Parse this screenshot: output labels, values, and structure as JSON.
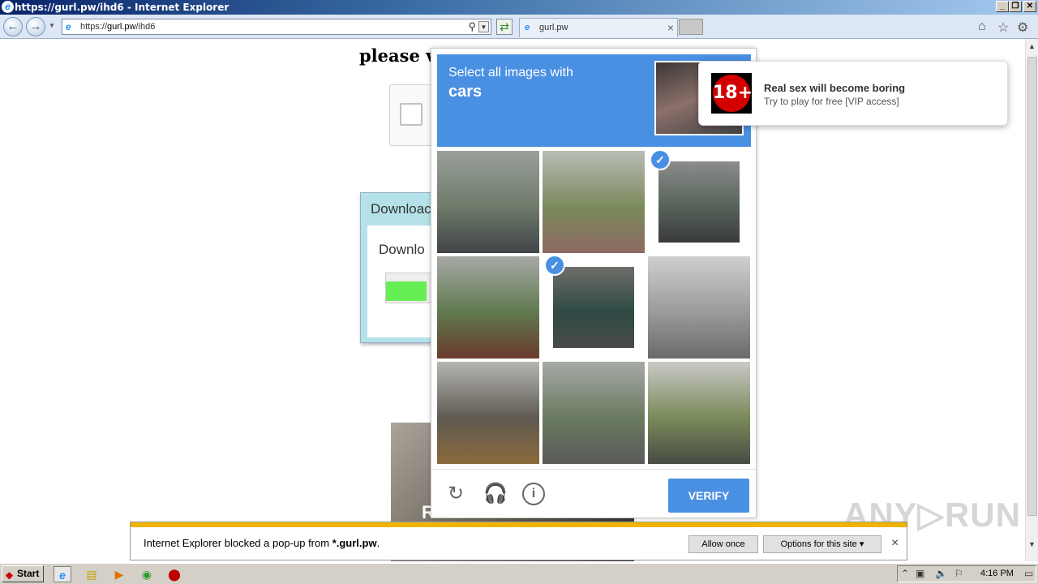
{
  "window": {
    "title": "https://gurl.pw/ihd6 - Internet Explorer",
    "minimize": "_",
    "restore": "❐",
    "close": "✕"
  },
  "toolbar": {
    "url_prefix": "https://",
    "url_host": "gurl.pw",
    "url_path": "/ihd6",
    "tab_label": "gurl.pw",
    "tab_close": "×"
  },
  "page": {
    "heading": "please ve",
    "download_title": "Downloac",
    "download_label": "Downlo",
    "download_progress": 0.75,
    "image_caption": "R"
  },
  "captcha": {
    "prompt": "Select all images with",
    "target": "cars",
    "verify_label": "VERIFY",
    "tiles": [
      {
        "name": "street-car-tile",
        "selected": false,
        "colors": [
          "#9aa09a",
          "#6e7a6a",
          "#404448"
        ]
      },
      {
        "name": "overpass-tile",
        "selected": false,
        "colors": [
          "#b9bcb5",
          "#7b8a5c",
          "#8d6a63"
        ]
      },
      {
        "name": "parked-car-tile",
        "selected": true,
        "colors": [
          "#8c8c8c",
          "#56635a",
          "#3a3a3c"
        ]
      },
      {
        "name": "chase-sign-tile",
        "selected": false,
        "colors": [
          "#a7a9a6",
          "#5f7a4e",
          "#6a3a2e"
        ]
      },
      {
        "name": "green-car-tile",
        "selected": true,
        "colors": [
          "#6f6e6a",
          "#2e4a44",
          "#4a4a48"
        ]
      },
      {
        "name": "empty-road-tile",
        "selected": false,
        "colors": [
          "#cfcfcf",
          "#9a9a9a",
          "#6a6a6a"
        ]
      },
      {
        "name": "traffic-light-tile",
        "selected": false,
        "colors": [
          "#b6b6b2",
          "#5e5a52",
          "#8a6a3a"
        ]
      },
      {
        "name": "rooftop-tile",
        "selected": false,
        "colors": [
          "#a6aaa6",
          "#6a7a60",
          "#5a5a58"
        ]
      },
      {
        "name": "signal-pole-tile",
        "selected": false,
        "colors": [
          "#c9c9c6",
          "#7a8a5a",
          "#484c44"
        ]
      }
    ]
  },
  "ad": {
    "badge": "18+",
    "title": "Real sex will become boring",
    "text": "Try to play for free [VIP access]"
  },
  "popup_bar": {
    "message_start": "Internet Explorer blocked a pop-up from ",
    "message_host": "*.gurl.pw",
    "message_end": ".",
    "allow_once": "Allow once",
    "options": "Options for this site ▾",
    "close": "×"
  },
  "watermark": "ANY▷RUN",
  "taskbar": {
    "start_label": "Start",
    "clock": "4:16 PM"
  },
  "colors": {
    "captcha_blue": "#4a90e2",
    "popup_stripe": "#f0b400",
    "ad_badge": "#d40000"
  }
}
